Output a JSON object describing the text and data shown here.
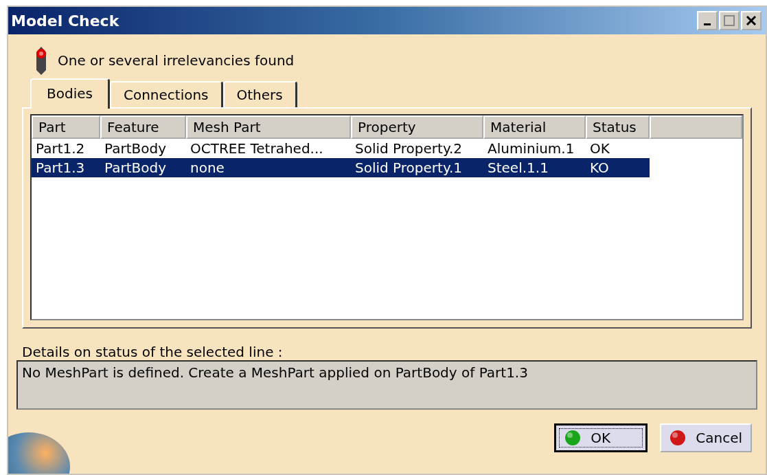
{
  "window": {
    "title": "Model Check"
  },
  "status": {
    "text": "One or several irrelevancies found",
    "error": true
  },
  "tabs": [
    {
      "label": "Bodies",
      "selected": true
    },
    {
      "label": "Connections",
      "selected": false
    },
    {
      "label": "Others",
      "selected": false
    }
  ],
  "table": {
    "columns": [
      "Part",
      "Feature",
      "Mesh Part",
      "Property",
      "Material",
      "Status"
    ],
    "rows": [
      {
        "cells": [
          "Part1.2",
          "PartBody",
          "OCTREE Tetrahed...",
          "Solid Property.2",
          "Aluminium.1",
          "OK"
        ],
        "selected": false
      },
      {
        "cells": [
          "Part1.3",
          "PartBody",
          "none",
          "Solid Property.1",
          "Steel.1.1",
          "KO"
        ],
        "selected": true
      }
    ]
  },
  "details": {
    "label": "Details on status of the selected line :",
    "text": "No MeshPart is defined. Create a MeshPart applied on PartBody of Part1.3"
  },
  "buttons": [
    {
      "label": "OK",
      "kind": "ok",
      "default": true
    },
    {
      "label": "Cancel",
      "kind": "cancel",
      "default": false
    }
  ]
}
